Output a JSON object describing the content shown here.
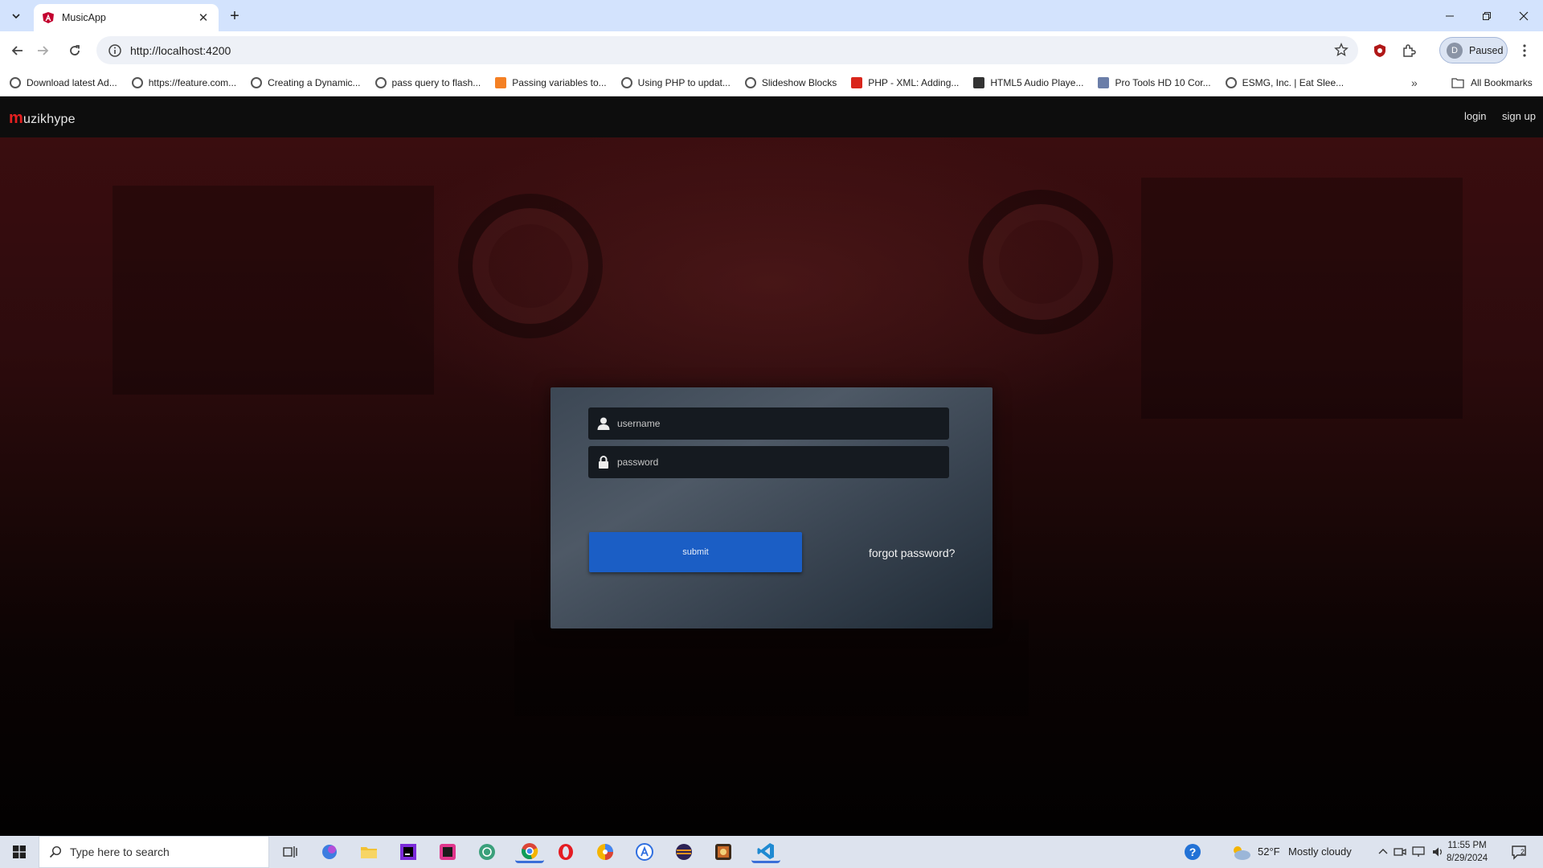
{
  "browser": {
    "tab_title": "MusicApp",
    "url": "http://localhost:4200",
    "profile_initial": "D",
    "profile_status": "Paused",
    "bookmarks": [
      "Download latest Ad...",
      "https://feature.com...",
      "Creating a Dynamic...",
      "pass query to flash...",
      "Passing variables to...",
      "Using PHP to updat...",
      "Slideshow Blocks",
      "PHP - XML: Adding...",
      "HTML5 Audio Playe...",
      "Pro Tools HD 10 Cor...",
      "ESMG, Inc. | Eat Slee..."
    ],
    "all_bookmarks": "All Bookmarks"
  },
  "app": {
    "brand_m": "m",
    "brand_rest": "uzikhype",
    "nav": {
      "login": "login",
      "signup": "sign up"
    },
    "form": {
      "username_placeholder": "username",
      "password_placeholder": "password",
      "submit": "submit",
      "forgot": "forgot password?"
    }
  },
  "taskbar": {
    "search_placeholder": "Type here to search",
    "weather_temp": "52°F",
    "weather_desc": "Mostly cloudy",
    "time": "11:55 PM",
    "date": "8/29/2024",
    "notifications": "2"
  },
  "colors": {
    "brand_accent": "#e52020",
    "submit_button": "#1b5ec5",
    "navbar": "#0d0d0d",
    "taskbar": "#dde3ee",
    "tabstrip": "#d3e3fd"
  }
}
